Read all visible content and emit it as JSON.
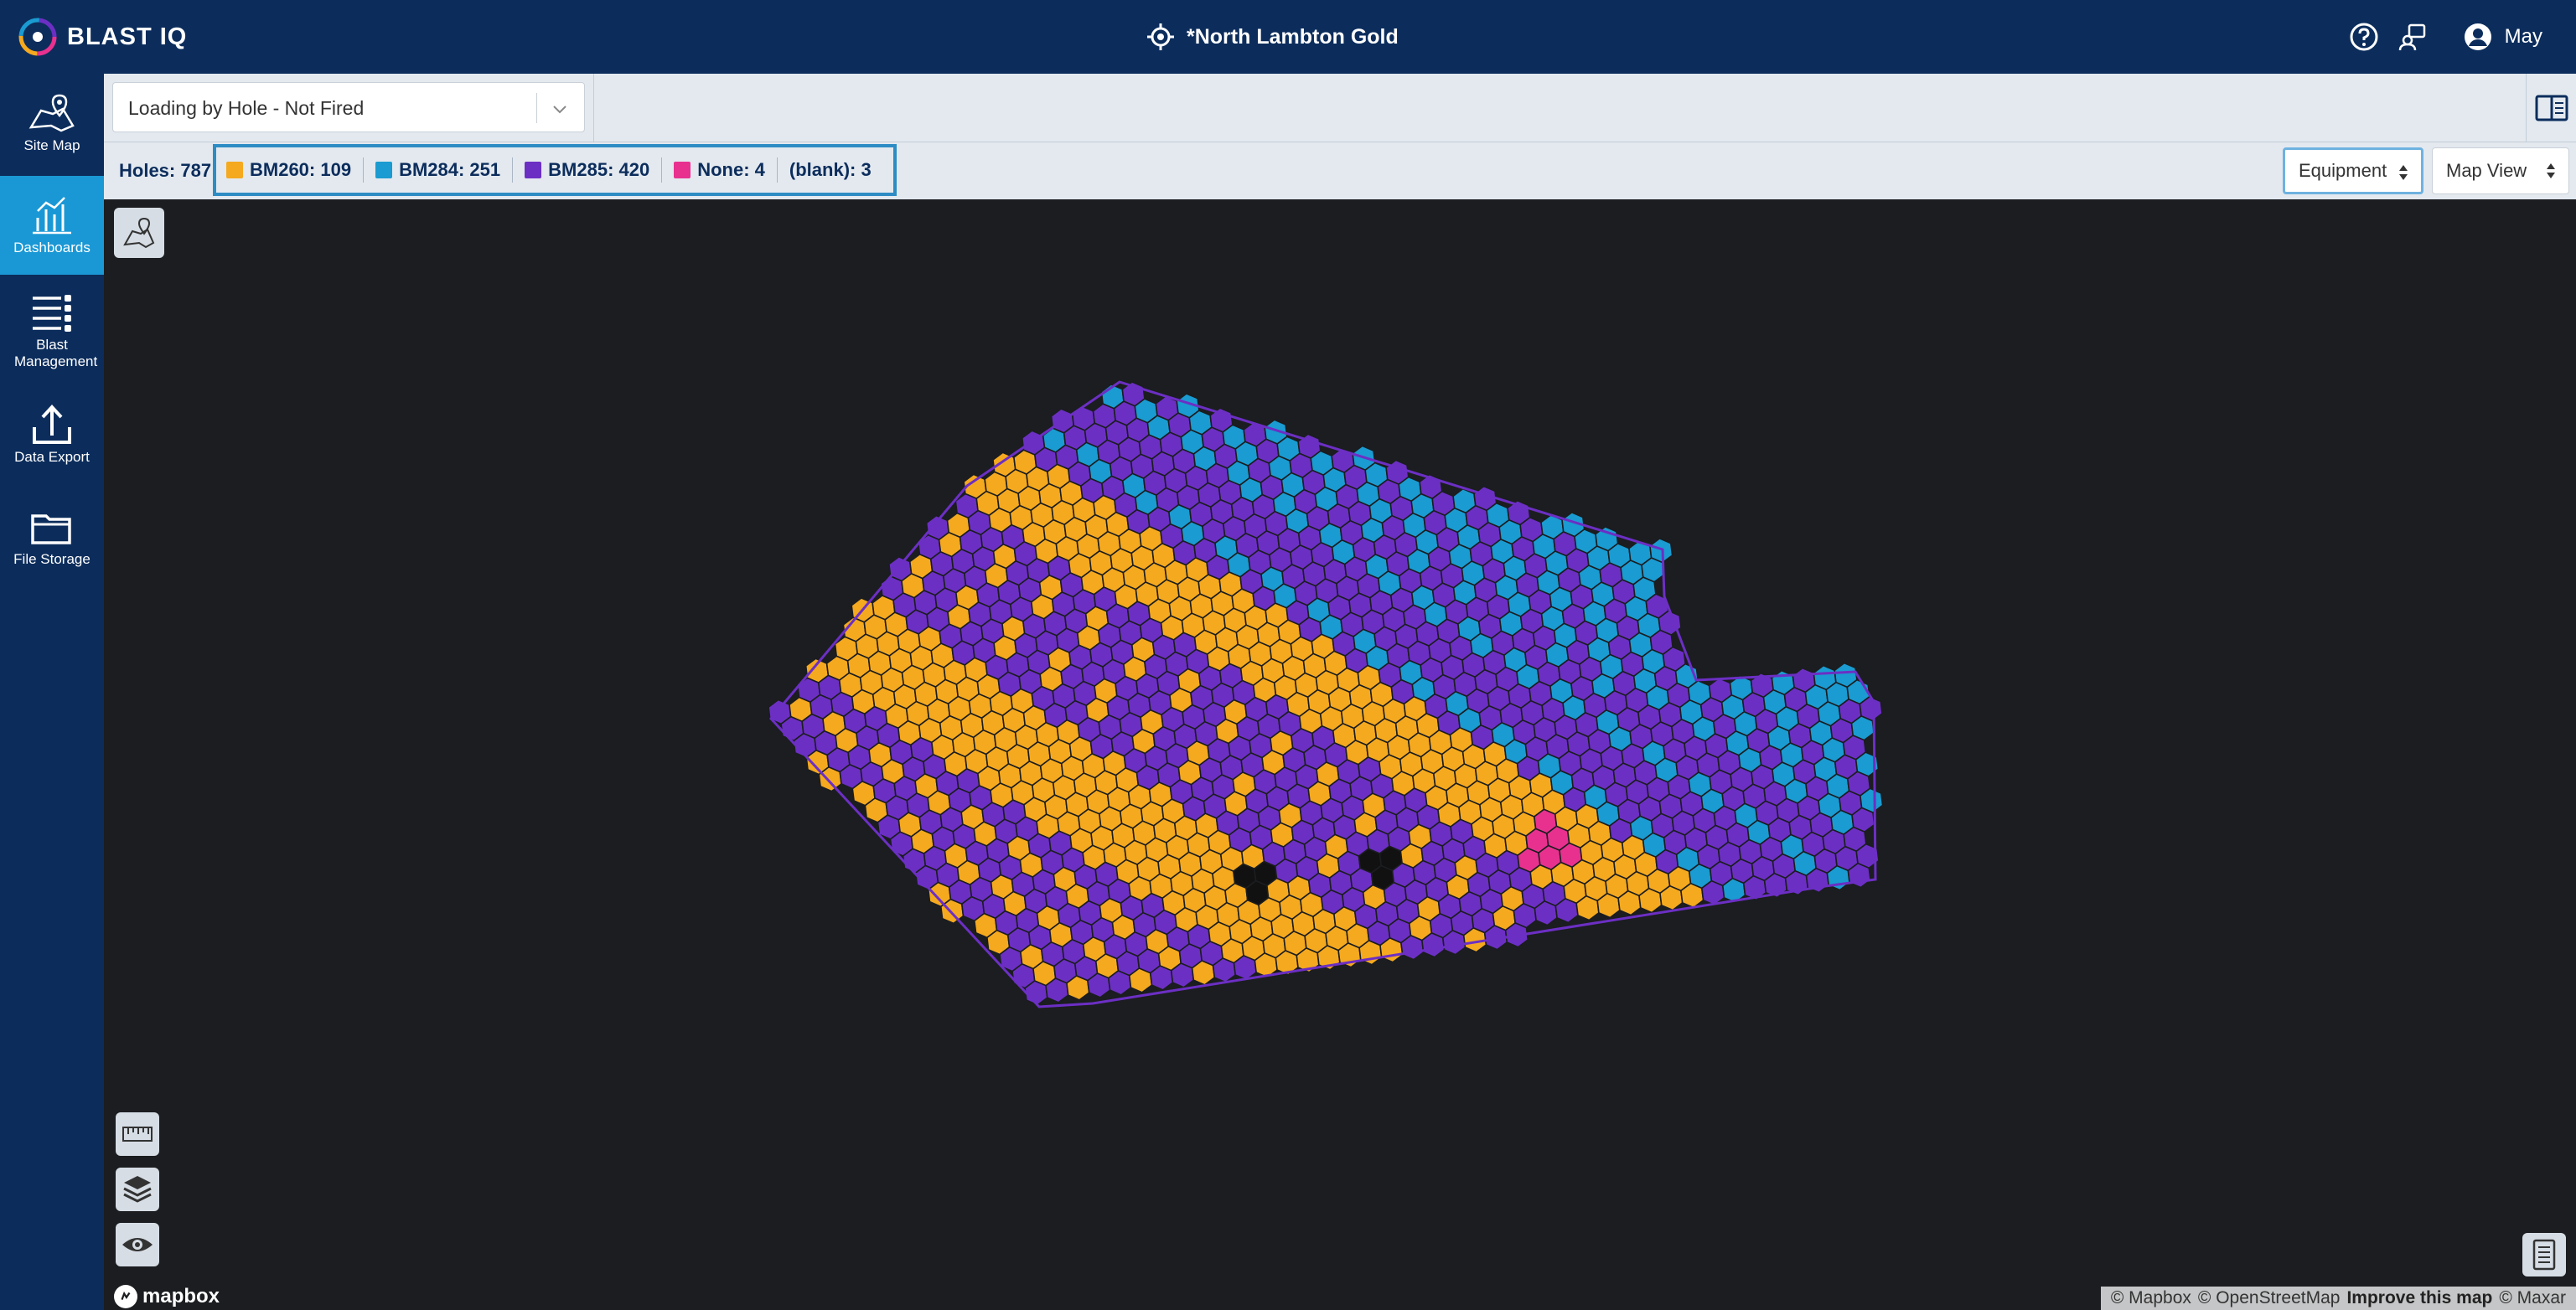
{
  "app": {
    "name": "BLAST IQ"
  },
  "header": {
    "site_name": "*North Lambton Gold",
    "user_name": "May"
  },
  "sidebar": {
    "items": [
      {
        "label": "Site Map",
        "icon": "map-pin-icon",
        "active": false
      },
      {
        "label": "Dashboards",
        "icon": "dashboard-chart-icon",
        "active": true
      },
      {
        "label": "Blast Management",
        "icon": "blast-management-icon",
        "active": false
      },
      {
        "label": "Data Export",
        "icon": "upload-icon",
        "active": false
      },
      {
        "label": "File Storage",
        "icon": "folder-icon",
        "active": false
      }
    ]
  },
  "toolbar": {
    "view_dropdown": "Loading by Hole - Not Fired",
    "holes_label": "Holes:",
    "holes_count": "787",
    "legend": [
      {
        "label": "BM260: 109",
        "color": "#f5a91f"
      },
      {
        "label": "BM284: 251",
        "color": "#1a9bd1"
      },
      {
        "label": "BM285: 420",
        "color": "#6c2fc4"
      },
      {
        "label": "None: 4",
        "color": "#e8318f"
      },
      {
        "label": "(blank): 3",
        "color": ""
      }
    ],
    "group_select": "Equipment",
    "view_select": "Map View"
  },
  "map": {
    "colors": {
      "BM260": "#f5a91f",
      "BM284": "#1a9bd1",
      "BM285": "#6c2fc4",
      "None": "#e8318f",
      "blank": "#111111"
    },
    "attribution": {
      "mapbox": "© Mapbox",
      "osm": "© OpenStreetMap",
      "improve": "Improve this map",
      "maxar": "© Maxar"
    },
    "logo_text": "mapbox"
  }
}
